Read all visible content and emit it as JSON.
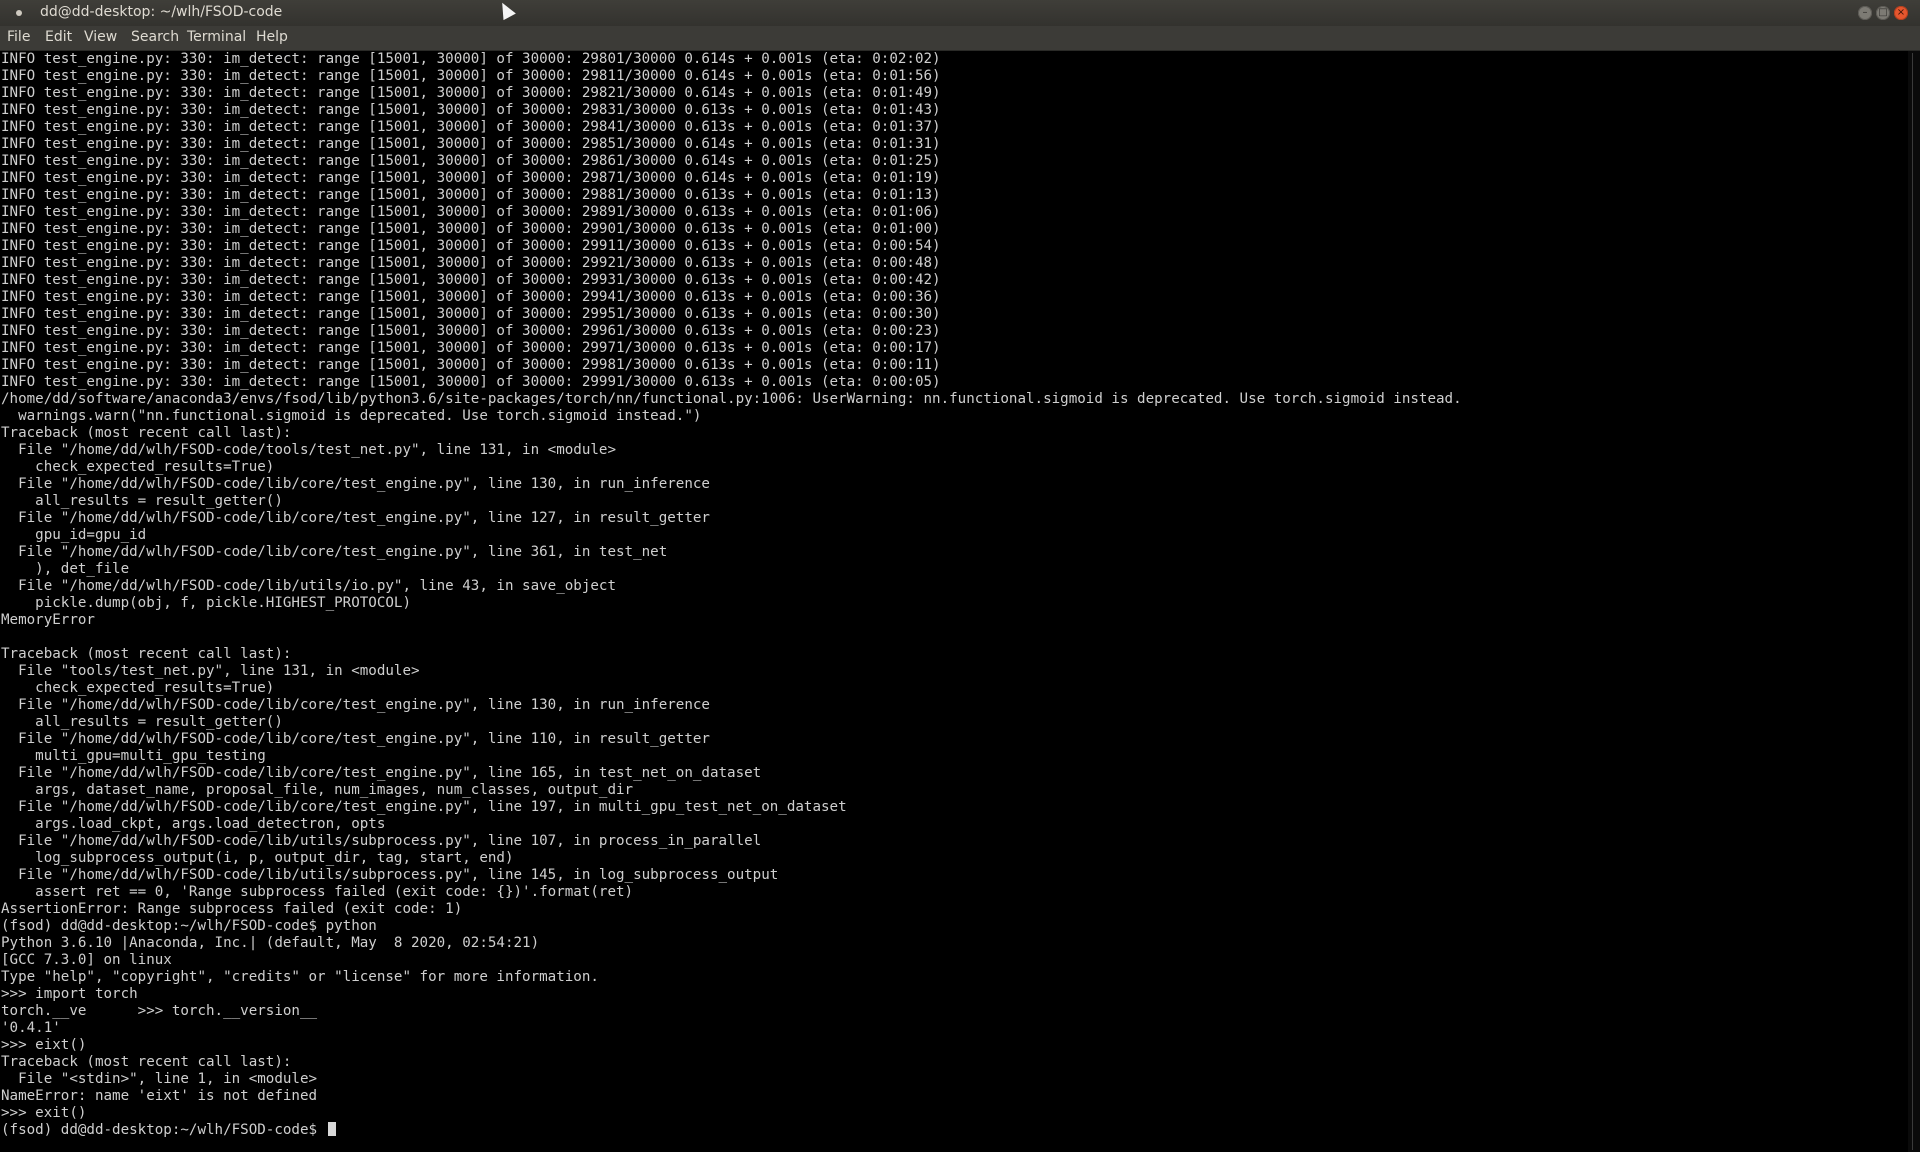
{
  "window": {
    "title": "dd@dd-desktop: ~/wlh/FSOD-code"
  },
  "menubar": {
    "items": [
      "File",
      "Edit",
      "View",
      "Search",
      "Terminal",
      "Help"
    ]
  },
  "terminal": {
    "lines": [
      "INFO test_engine.py: 330: im_detect: range [15001, 30000] of 30000: 29801/30000 0.614s + 0.001s (eta: 0:02:02)",
      "INFO test_engine.py: 330: im_detect: range [15001, 30000] of 30000: 29811/30000 0.614s + 0.001s (eta: 0:01:56)",
      "INFO test_engine.py: 330: im_detect: range [15001, 30000] of 30000: 29821/30000 0.614s + 0.001s (eta: 0:01:49)",
      "INFO test_engine.py: 330: im_detect: range [15001, 30000] of 30000: 29831/30000 0.613s + 0.001s (eta: 0:01:43)",
      "INFO test_engine.py: 330: im_detect: range [15001, 30000] of 30000: 29841/30000 0.613s + 0.001s (eta: 0:01:37)",
      "INFO test_engine.py: 330: im_detect: range [15001, 30000] of 30000: 29851/30000 0.614s + 0.001s (eta: 0:01:31)",
      "INFO test_engine.py: 330: im_detect: range [15001, 30000] of 30000: 29861/30000 0.614s + 0.001s (eta: 0:01:25)",
      "INFO test_engine.py: 330: im_detect: range [15001, 30000] of 30000: 29871/30000 0.614s + 0.001s (eta: 0:01:19)",
      "INFO test_engine.py: 330: im_detect: range [15001, 30000] of 30000: 29881/30000 0.613s + 0.001s (eta: 0:01:13)",
      "INFO test_engine.py: 330: im_detect: range [15001, 30000] of 30000: 29891/30000 0.613s + 0.001s (eta: 0:01:06)",
      "INFO test_engine.py: 330: im_detect: range [15001, 30000] of 30000: 29901/30000 0.613s + 0.001s (eta: 0:01:00)",
      "INFO test_engine.py: 330: im_detect: range [15001, 30000] of 30000: 29911/30000 0.613s + 0.001s (eta: 0:00:54)",
      "INFO test_engine.py: 330: im_detect: range [15001, 30000] of 30000: 29921/30000 0.613s + 0.001s (eta: 0:00:48)",
      "INFO test_engine.py: 330: im_detect: range [15001, 30000] of 30000: 29931/30000 0.613s + 0.001s (eta: 0:00:42)",
      "INFO test_engine.py: 330: im_detect: range [15001, 30000] of 30000: 29941/30000 0.613s + 0.001s (eta: 0:00:36)",
      "INFO test_engine.py: 330: im_detect: range [15001, 30000] of 30000: 29951/30000 0.613s + 0.001s (eta: 0:00:30)",
      "INFO test_engine.py: 330: im_detect: range [15001, 30000] of 30000: 29961/30000 0.613s + 0.001s (eta: 0:00:23)",
      "INFO test_engine.py: 330: im_detect: range [15001, 30000] of 30000: 29971/30000 0.613s + 0.001s (eta: 0:00:17)",
      "INFO test_engine.py: 330: im_detect: range [15001, 30000] of 30000: 29981/30000 0.613s + 0.001s (eta: 0:00:11)",
      "INFO test_engine.py: 330: im_detect: range [15001, 30000] of 30000: 29991/30000 0.613s + 0.001s (eta: 0:00:05)",
      "/home/dd/software/anaconda3/envs/fsod/lib/python3.6/site-packages/torch/nn/functional.py:1006: UserWarning: nn.functional.sigmoid is deprecated. Use torch.sigmoid instead.",
      "  warnings.warn(\"nn.functional.sigmoid is deprecated. Use torch.sigmoid instead.\")",
      "Traceback (most recent call last):",
      "  File \"/home/dd/wlh/FSOD-code/tools/test_net.py\", line 131, in <module>",
      "    check_expected_results=True)",
      "  File \"/home/dd/wlh/FSOD-code/lib/core/test_engine.py\", line 130, in run_inference",
      "    all_results = result_getter()",
      "  File \"/home/dd/wlh/FSOD-code/lib/core/test_engine.py\", line 127, in result_getter",
      "    gpu_id=gpu_id",
      "  File \"/home/dd/wlh/FSOD-code/lib/core/test_engine.py\", line 361, in test_net",
      "    ), det_file",
      "  File \"/home/dd/wlh/FSOD-code/lib/utils/io.py\", line 43, in save_object",
      "    pickle.dump(obj, f, pickle.HIGHEST_PROTOCOL)",
      "MemoryError",
      "",
      "Traceback (most recent call last):",
      "  File \"tools/test_net.py\", line 131, in <module>",
      "    check_expected_results=True)",
      "  File \"/home/dd/wlh/FSOD-code/lib/core/test_engine.py\", line 130, in run_inference",
      "    all_results = result_getter()",
      "  File \"/home/dd/wlh/FSOD-code/lib/core/test_engine.py\", line 110, in result_getter",
      "    multi_gpu=multi_gpu_testing",
      "  File \"/home/dd/wlh/FSOD-code/lib/core/test_engine.py\", line 165, in test_net_on_dataset",
      "    args, dataset_name, proposal_file, num_images, num_classes, output_dir",
      "  File \"/home/dd/wlh/FSOD-code/lib/core/test_engine.py\", line 197, in multi_gpu_test_net_on_dataset",
      "    args.load_ckpt, args.load_detectron, opts",
      "  File \"/home/dd/wlh/FSOD-code/lib/utils/subprocess.py\", line 107, in process_in_parallel",
      "    log_subprocess_output(i, p, output_dir, tag, start, end)",
      "  File \"/home/dd/wlh/FSOD-code/lib/utils/subprocess.py\", line 145, in log_subprocess_output",
      "    assert ret == 0, 'Range subprocess failed (exit code: {})'.format(ret)",
      "AssertionError: Range subprocess failed (exit code: 1)",
      "(fsod) dd@dd-desktop:~/wlh/FSOD-code$ python",
      "Python 3.6.10 |Anaconda, Inc.| (default, May  8 2020, 02:54:21)",
      "[GCC 7.3.0] on linux",
      "Type \"help\", \"copyright\", \"credits\" or \"license\" for more information.",
      ">>> import torch",
      "torch.__ve      >>> torch.__version__",
      "'0.4.1'",
      ">>> eixt()",
      "Traceback (most recent call last):",
      "  File \"<stdin>\", line 1, in <module>",
      "NameError: name 'eixt' is not defined",
      ">>> exit()"
    ],
    "prompt": "(fsod) dd@dd-desktop:~/wlh/FSOD-code$ "
  },
  "colors": {
    "terminal_bg": "#000000",
    "terminal_fg": "#cfcfcf",
    "titlebar_bg": "#3c3b37",
    "close_button": "#e5562e"
  },
  "icons": {
    "window_menu": "window-menu-icon",
    "minimize": "minimize-icon",
    "maximize": "maximize-icon",
    "close": "close-icon"
  }
}
